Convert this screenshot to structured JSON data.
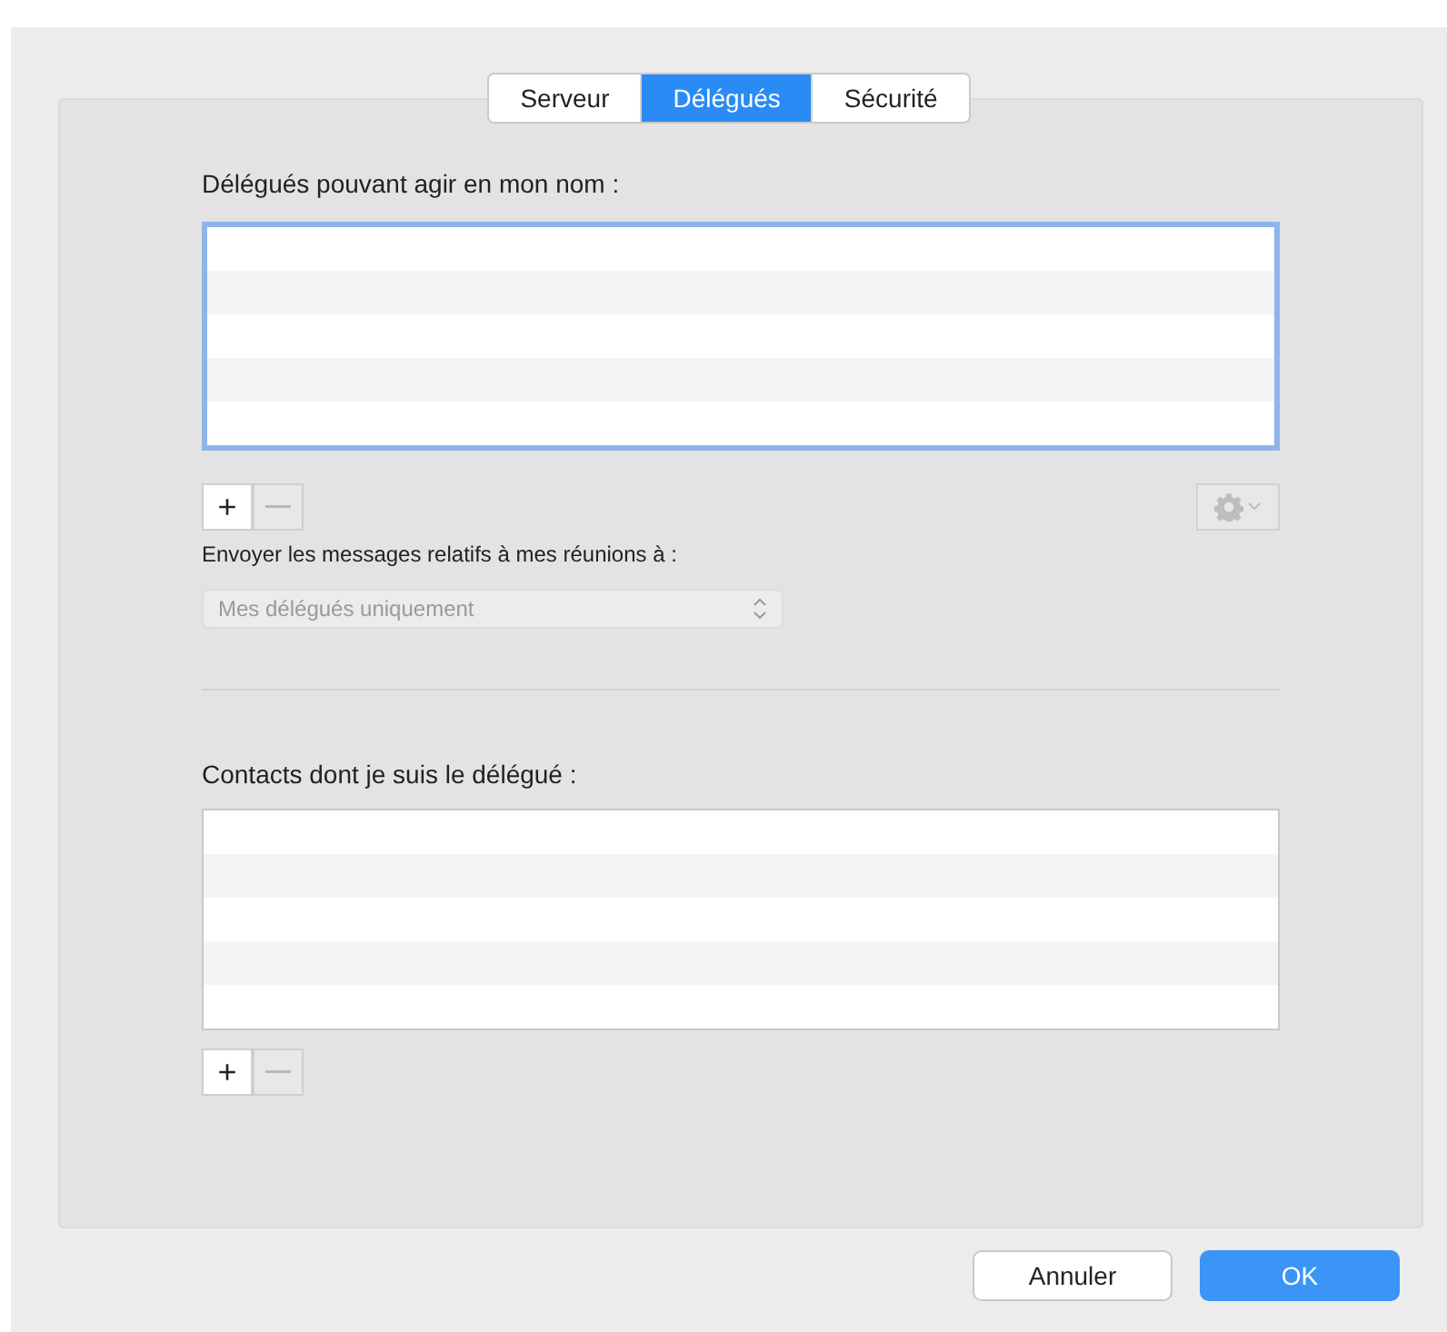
{
  "tabs": [
    {
      "label": "Serveur",
      "selected": false
    },
    {
      "label": "Délégués",
      "selected": true
    },
    {
      "label": "Sécurité",
      "selected": false
    }
  ],
  "delegates": {
    "label": "Délégués pouvant agir en mon nom :",
    "focused": true,
    "add": {
      "label": "+",
      "disabled": false
    },
    "remove": {
      "disabled": true
    },
    "action_menu": {
      "disabled": true
    }
  },
  "meeting_messages": {
    "label": "Envoyer les messages relatifs à mes réunions à :",
    "select": {
      "value": "Mes délégués uniquement",
      "disabled": true
    }
  },
  "delegated_by": {
    "label": "Contacts dont je suis le délégué :",
    "focused": false,
    "add": {
      "label": "+",
      "disabled": false
    },
    "remove": {
      "disabled": true
    }
  },
  "buttons": [
    {
      "label": "Annuler",
      "kind": "cancel"
    },
    {
      "label": "OK",
      "kind": "default"
    }
  ]
}
